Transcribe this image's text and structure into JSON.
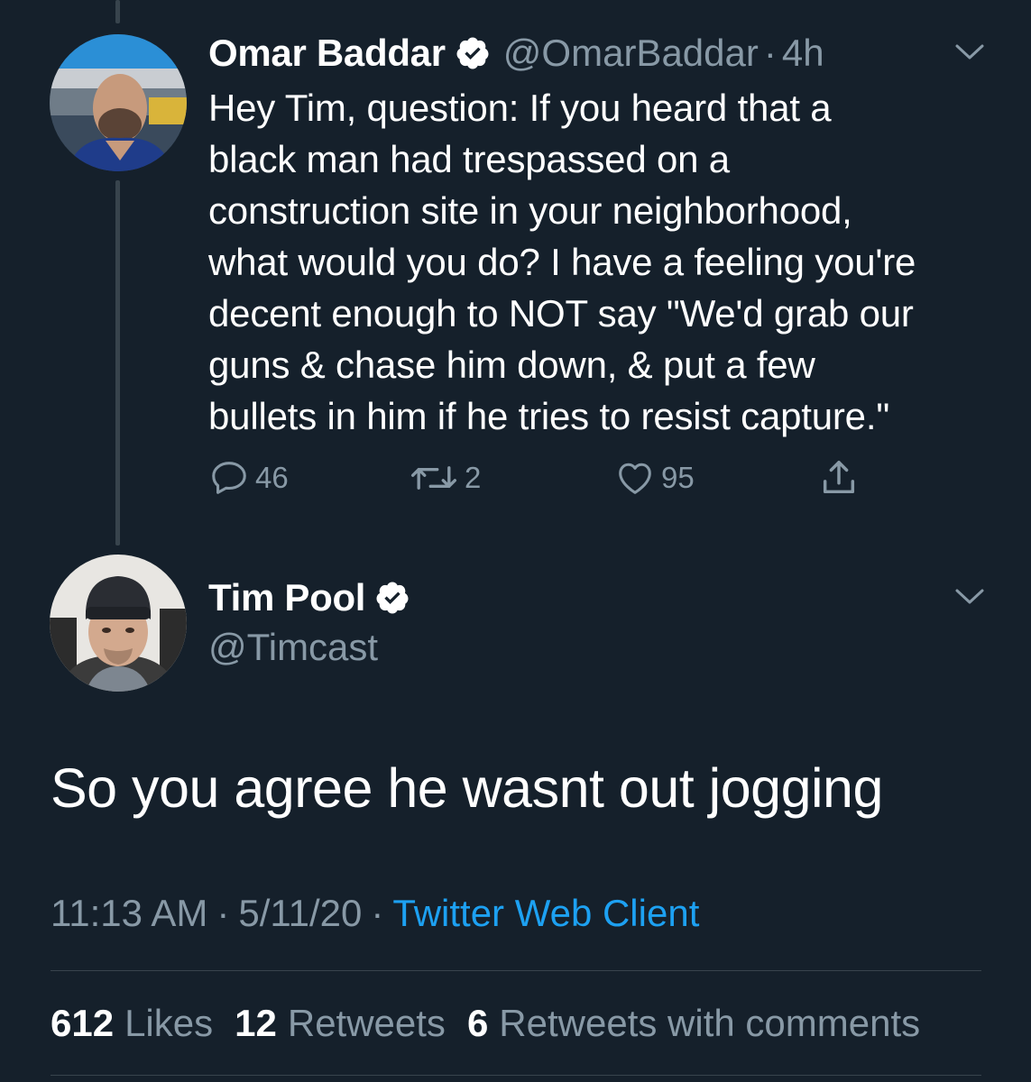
{
  "reply_tweet": {
    "display_name": "Omar Baddar",
    "handle": "@OmarBaddar",
    "separator": "·",
    "time": "4h",
    "text": "Hey Tim, question: If you heard that a\nblack man had trespassed on a\nconstruction site in your neighborhood,\nwhat would you do? I have a feeling you're\ndecent enough to NOT say \"We'd grab our\nguns & chase him down, & put a few\nbullets in him if he tries to resist capture.\"",
    "actions": {
      "replies": "46",
      "retweets": "2",
      "likes": "95"
    }
  },
  "main_tweet": {
    "display_name": "Tim Pool",
    "handle": "@Timcast",
    "text": "So you agree he wasnt out jogging",
    "time": "11:13 AM",
    "date": "5/11/20",
    "separator": "·",
    "client": "Twitter Web Client",
    "stats": {
      "likes_count": "612",
      "likes_label": "Likes",
      "retweets_count": "12",
      "retweets_label": "Retweets",
      "quotes_count": "6",
      "quotes_label": "Retweets with comments"
    }
  },
  "colors": {
    "background": "#15202b",
    "secondary_text": "#8899a6",
    "link": "#1da1f2",
    "divider": "#38444d"
  },
  "icons": [
    "verified-badge-icon",
    "chevron-down-icon",
    "reply-icon",
    "retweet-icon",
    "like-icon",
    "share-icon"
  ]
}
